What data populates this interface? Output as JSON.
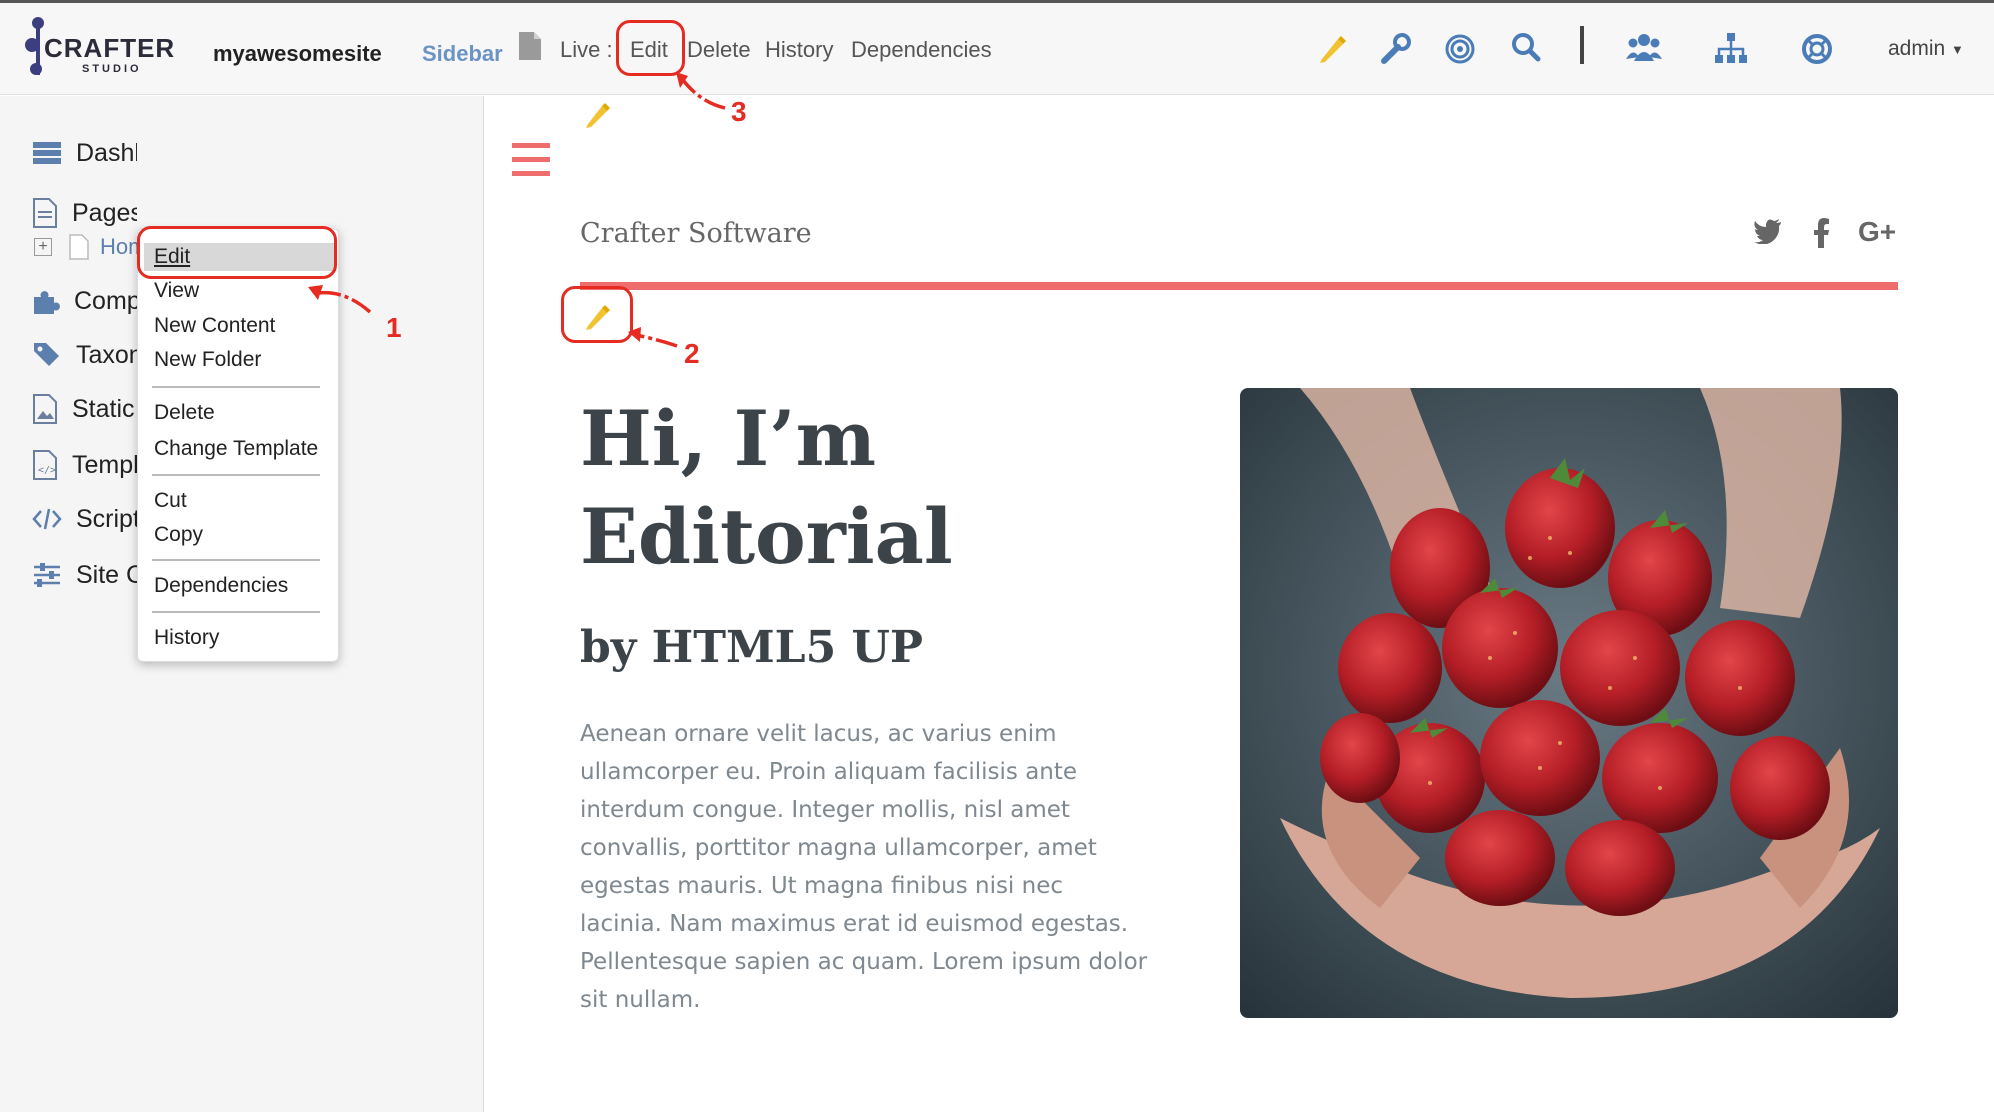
{
  "header": {
    "logo_word": "CRAFTER",
    "logo_sub": "STUDIO",
    "site_name": "myawesomesite",
    "sidebar_label": "Sidebar",
    "live_label": "Live :",
    "nav": [
      "Edit",
      "Delete",
      "History",
      "Dependencies"
    ],
    "admin_label": "admin"
  },
  "sidebar": {
    "items": [
      {
        "label": "Dashboard"
      },
      {
        "label": "Pages"
      },
      {
        "label": "Components"
      },
      {
        "label": "Taxonomy"
      },
      {
        "label": "Static Assets"
      },
      {
        "label": "Templates"
      },
      {
        "label": "Scripts"
      },
      {
        "label": "Site Config"
      }
    ],
    "tree_home": "Home"
  },
  "context_menu": {
    "items": [
      "Edit",
      "View",
      "New Content",
      "New Folder",
      "Delete",
      "Change Template",
      "Cut",
      "Copy",
      "Dependencies",
      "History"
    ]
  },
  "preview": {
    "brand": "Crafter Software",
    "title_line1": "Hi, I’m",
    "title_line2": "Editorial",
    "subtitle": "by HTML5 UP",
    "body": "Aenean ornare velit lacus, ac varius enim ullamcorper eu. Proin aliquam facilisis ante interdum congue. Integer mollis, nisl amet convallis, porttitor magna ullamcorper, amet egestas mauris. Ut magna finibus nisi nec lacinia. Nam maximus erat id euismod egestas. Pellentesque sapien ac quam. Lorem ipsum dolor sit nullam.",
    "social_gplus": "G+"
  },
  "annotations": {
    "one": "1",
    "two": "2",
    "three": "3"
  },
  "colors": {
    "accent_red": "#f06d6d",
    "annotation_red": "#e52b22",
    "pencil_yellow": "#f2c230",
    "sidebar_blue": "#6b93c4"
  }
}
